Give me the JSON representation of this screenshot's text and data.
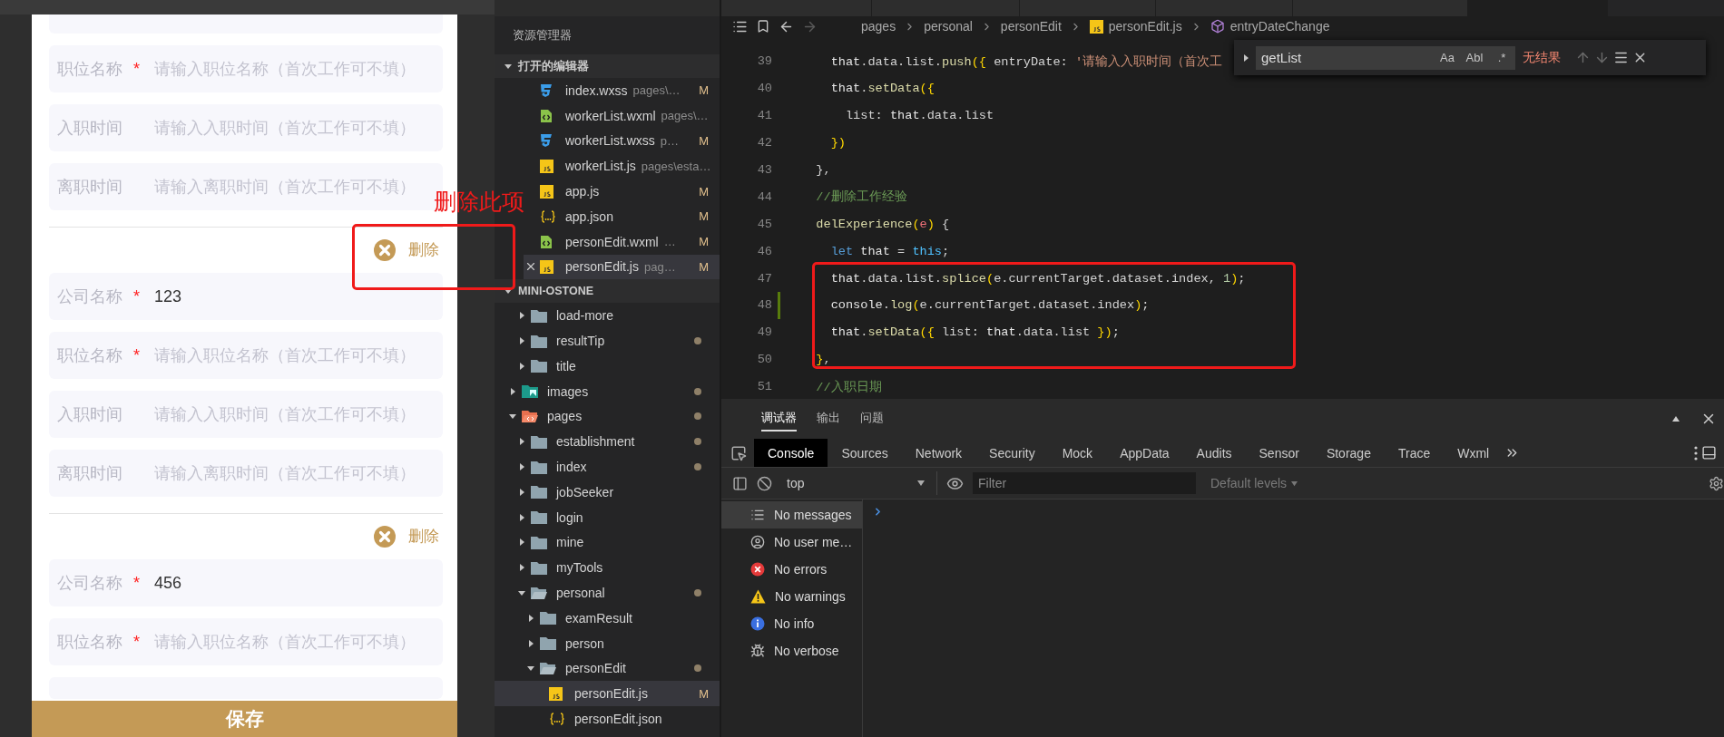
{
  "simulator": {
    "form": [
      {
        "kind": "field_cut"
      },
      {
        "kind": "field",
        "label": "职位名称",
        "mark": "*",
        "placeholder": "请输入职位名称（首次工作可不填）"
      },
      {
        "kind": "field",
        "label": "入职时间",
        "placeholder": "请输入入职时间（首次工作可不填）"
      },
      {
        "kind": "field",
        "label": "离职时间",
        "placeholder": "请输入离职时间（首次工作可不填）"
      },
      {
        "kind": "divider"
      },
      {
        "kind": "delete",
        "label": "删除"
      },
      {
        "kind": "field",
        "label": "公司名称",
        "mark": "*",
        "value": "123"
      },
      {
        "kind": "field",
        "label": "职位名称",
        "mark": "*",
        "placeholder": "请输入职位名称（首次工作可不填）"
      },
      {
        "kind": "field",
        "label": "入职时间",
        "placeholder": "请输入入职时间（首次工作可不填）"
      },
      {
        "kind": "field",
        "label": "离职时间",
        "placeholder": "请输入离职时间（首次工作可不填）"
      },
      {
        "kind": "divider"
      },
      {
        "kind": "delete",
        "label": "删除"
      },
      {
        "kind": "field",
        "label": "公司名称",
        "mark": "*",
        "value": "456"
      },
      {
        "kind": "field",
        "label": "职位名称",
        "mark": "*",
        "placeholder": "请输入职位名称（首次工作可不填）"
      },
      {
        "kind": "field_cut"
      }
    ],
    "save_button": "保存"
  },
  "annotation": {
    "text": "删除此项"
  },
  "explorer": {
    "title": "资源管理器",
    "open_editors": {
      "title": "打开的编辑器",
      "expanded": true,
      "items": [
        {
          "name": "index.wxss",
          "path": "pages\\…",
          "badge": "M",
          "kind": "css",
          "selected": false
        },
        {
          "name": "workerList.wxml",
          "path": "pages\\…",
          "kind": "wxml",
          "selected": false
        },
        {
          "name": "workerList.wxss",
          "path": "p…",
          "badge": "M",
          "kind": "css",
          "selected": false
        },
        {
          "name": "workerList.js",
          "path": "pages\\esta…",
          "kind": "js",
          "selected": false
        },
        {
          "name": "app.js",
          "badge": "M",
          "kind": "js",
          "selected": false
        },
        {
          "name": "app.json",
          "badge": "M",
          "kind": "json",
          "selected": false
        },
        {
          "name": "personEdit.wxml",
          "path": "…",
          "badge": "M",
          "kind": "wxml",
          "selected": false
        },
        {
          "name": "personEdit.js",
          "path": "pag…",
          "badge": "M",
          "kind": "js",
          "selected": true
        }
      ]
    },
    "project": {
      "title": "MINI-OSTONE",
      "expanded": true,
      "continued": [
        {
          "name": "load-more",
          "kind": "folder",
          "expanded": false,
          "modified": false,
          "selected": false
        },
        {
          "name": "resultTip",
          "kind": "folder",
          "expanded": false,
          "modified": true,
          "selected": false
        },
        {
          "name": "title",
          "kind": "folder",
          "expanded": false,
          "modified": false,
          "selected": false
        }
      ],
      "items": [
        {
          "name": "images",
          "kind": "images",
          "expanded": false,
          "modified": true,
          "selected": false
        },
        {
          "name": "pages",
          "kind": "pages",
          "expanded": true,
          "modified": true,
          "selected": false,
          "children": [
            {
              "name": "establishment",
              "kind": "folder",
              "expanded": false,
              "modified": true,
              "selected": false
            },
            {
              "name": "index",
              "kind": "folder",
              "expanded": false,
              "modified": true,
              "selected": false
            },
            {
              "name": "jobSeeker",
              "kind": "folder",
              "expanded": false,
              "modified": false,
              "selected": false
            },
            {
              "name": "login",
              "kind": "folder",
              "expanded": false,
              "modified": false,
              "selected": false
            },
            {
              "name": "mine",
              "kind": "folder",
              "expanded": false,
              "modified": false,
              "selected": false
            },
            {
              "name": "myTools",
              "kind": "folder",
              "expanded": false,
              "modified": false,
              "selected": false
            },
            {
              "name": "personal",
              "kind": "folder",
              "expanded": true,
              "modified": true,
              "selected": false,
              "children": [
                {
                  "name": "examResult",
                  "kind": "folder",
                  "expanded": false,
                  "modified": false,
                  "selected": false
                },
                {
                  "name": "person",
                  "kind": "folder",
                  "expanded": false,
                  "modified": false,
                  "selected": false
                },
                {
                  "name": "personEdit",
                  "kind": "folder",
                  "expanded": true,
                  "modified": true,
                  "selected": false,
                  "children": [
                    {
                      "name": "personEdit.js",
                      "kind": "js",
                      "badge": "M",
                      "modified": false,
                      "selected": true
                    },
                    {
                      "name": "personEdit.json",
                      "kind": "json",
                      "modified": false,
                      "selected": false
                    }
                  ]
                }
              ]
            }
          ]
        }
      ]
    }
  },
  "editor": {
    "tabs": [
      {
        "selected": false
      },
      {
        "selected": false
      },
      {
        "selected": false
      },
      {
        "selected": false
      },
      {
        "selected": false
      },
      {
        "selected": true
      }
    ],
    "breadcrumb": [
      {
        "text": "pages",
        "kind": "folder"
      },
      {
        "text": "personal",
        "kind": "folder"
      },
      {
        "text": "personEdit",
        "kind": "folder"
      },
      {
        "text": "personEdit.js",
        "kind": "js"
      },
      {
        "text": "entryDateChange",
        "kind": "method"
      }
    ],
    "lines": [
      {
        "number": "39",
        "modified": false,
        "tokens": [
          {
            "kind": "var",
            "text": "    that"
          },
          {
            "kind": "plain",
            "text": ".data.list."
          },
          {
            "kind": "fn",
            "text": "push"
          },
          {
            "kind": "bracket",
            "text": "({"
          },
          {
            "kind": "plain",
            "text": " entryDate: "
          },
          {
            "kind": "str",
            "text": "'请输入入职时间（首次工"
          }
        ]
      },
      {
        "number": "40",
        "modified": false,
        "tokens": [
          {
            "kind": "var",
            "text": "    that"
          },
          {
            "kind": "plain",
            "text": "."
          },
          {
            "kind": "fn",
            "text": "setData"
          },
          {
            "kind": "bracket",
            "text": "({"
          }
        ]
      },
      {
        "number": "41",
        "modified": false,
        "tokens": [
          {
            "kind": "plain",
            "text": "      list: "
          },
          {
            "kind": "var",
            "text": "that"
          },
          {
            "kind": "plain",
            "text": ".data.list"
          }
        ]
      },
      {
        "number": "42",
        "modified": false,
        "tokens": [
          {
            "kind": "bracket",
            "text": "    })"
          }
        ]
      },
      {
        "number": "43",
        "modified": false,
        "tokens": [
          {
            "kind": "plain",
            "text": "  },"
          }
        ]
      },
      {
        "number": "44",
        "modified": false,
        "tokens": [
          {
            "kind": "comment",
            "text": "  //删除工作经验"
          }
        ]
      },
      {
        "number": "45",
        "modified": false,
        "tokens": [
          {
            "kind": "fn",
            "text": "  delExperience"
          },
          {
            "kind": "bracket",
            "text": "("
          },
          {
            "kind": "param",
            "text": "e"
          },
          {
            "kind": "bracket",
            "text": ")"
          },
          {
            "kind": "plain",
            "text": " {"
          }
        ]
      },
      {
        "number": "46",
        "modified": false,
        "tokens": [
          {
            "kind": "kw",
            "text": "    let"
          },
          {
            "kind": "var",
            "text": " that"
          },
          {
            "kind": "plain",
            "text": " = "
          },
          {
            "kind": "this",
            "text": "this"
          },
          {
            "kind": "plain",
            "text": ";"
          }
        ]
      },
      {
        "number": "47",
        "modified": false,
        "tokens": [
          {
            "kind": "var",
            "text": "    that"
          },
          {
            "kind": "plain",
            "text": ".data.list."
          },
          {
            "kind": "fn",
            "text": "splice"
          },
          {
            "kind": "bracket",
            "text": "("
          },
          {
            "kind": "plain",
            "text": "e.currentTarget.dataset.index, "
          },
          {
            "kind": "num",
            "text": "1"
          },
          {
            "kind": "bracket",
            "text": ")"
          },
          {
            "kind": "plain",
            "text": ";"
          }
        ]
      },
      {
        "number": "48",
        "modified": true,
        "tokens": [
          {
            "kind": "var",
            "text": "    console"
          },
          {
            "kind": "plain",
            "text": "."
          },
          {
            "kind": "fn",
            "text": "log"
          },
          {
            "kind": "bracket",
            "text": "("
          },
          {
            "kind": "plain",
            "text": "e.currentTarget.dataset.index"
          },
          {
            "kind": "bracket",
            "text": ")"
          },
          {
            "kind": "plain",
            "text": ";"
          }
        ]
      },
      {
        "number": "49",
        "modified": false,
        "tokens": [
          {
            "kind": "var",
            "text": "    that"
          },
          {
            "kind": "plain",
            "text": "."
          },
          {
            "kind": "fn",
            "text": "setData"
          },
          {
            "kind": "bracket",
            "text": "({"
          },
          {
            "kind": "plain",
            "text": " list: "
          },
          {
            "kind": "var",
            "text": "that"
          },
          {
            "kind": "plain",
            "text": ".data.list "
          },
          {
            "kind": "bracket",
            "text": "})"
          },
          {
            "kind": "plain",
            "text": ";"
          }
        ]
      },
      {
        "number": "50",
        "modified": false,
        "tokens": [
          {
            "kind": "bracket",
            "text": "  }"
          },
          {
            "kind": "plain",
            "text": ","
          }
        ]
      },
      {
        "number": "51",
        "modified": false,
        "tokens": [
          {
            "kind": "comment",
            "text": "  //入职日期"
          }
        ]
      }
    ],
    "find": {
      "value": "getList",
      "options": [
        "Aa",
        "Abl",
        ".*"
      ],
      "result": "无结果"
    }
  },
  "devtools": {
    "panels": [
      {
        "label": "调试器",
        "selected": true
      },
      {
        "label": "输出",
        "selected": false
      },
      {
        "label": "问题",
        "selected": false
      }
    ],
    "tabs": [
      {
        "label": "Console",
        "selected": true
      },
      {
        "label": "Sources",
        "selected": false
      },
      {
        "label": "Network",
        "selected": false
      },
      {
        "label": "Security",
        "selected": false
      },
      {
        "label": "Mock",
        "selected": false
      },
      {
        "label": "AppData",
        "selected": false
      },
      {
        "label": "Audits",
        "selected": false
      },
      {
        "label": "Sensor",
        "selected": false
      },
      {
        "label": "Storage",
        "selected": false
      },
      {
        "label": "Trace",
        "selected": false
      },
      {
        "label": "Wxml",
        "selected": false
      }
    ],
    "toolbar": {
      "context": "top",
      "filter_placeholder": "Filter",
      "levels": "Default levels"
    },
    "sidebar": [
      {
        "label": "No messages",
        "kind": "messages",
        "selected": true
      },
      {
        "label": "No user me…",
        "kind": "user",
        "selected": false
      },
      {
        "label": "No errors",
        "kind": "errors",
        "selected": false
      },
      {
        "label": "No warnings",
        "kind": "warnings",
        "selected": false
      },
      {
        "label": "No info",
        "kind": "info",
        "selected": false
      },
      {
        "label": "No verbose",
        "kind": "verbose",
        "selected": false
      }
    ]
  }
}
